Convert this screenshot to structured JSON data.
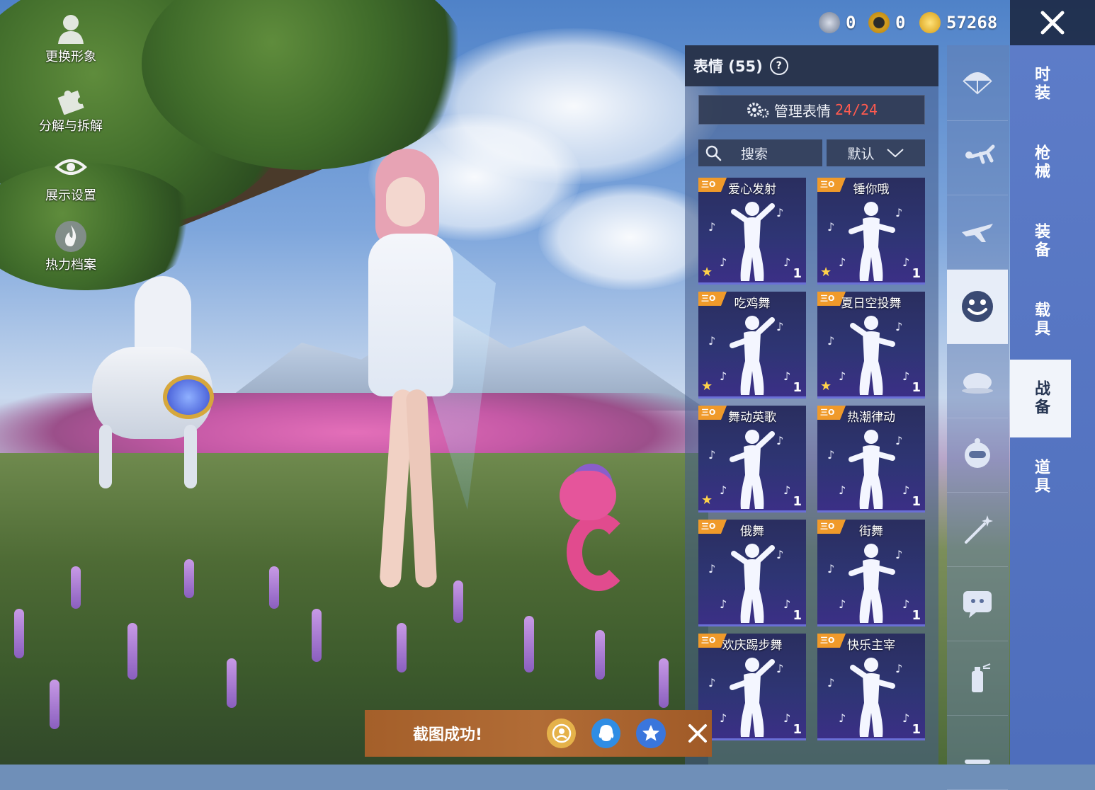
{
  "left_menu": [
    {
      "label": "更换形象",
      "icon": "person-icon"
    },
    {
      "label": "分解与拆解",
      "icon": "puzzle-icon"
    },
    {
      "label": "展示设置",
      "icon": "eye-icon"
    },
    {
      "label": "热力档案",
      "icon": "flame-icon"
    }
  ],
  "currency": [
    {
      "icon": "silver-coin-icon",
      "value": "0"
    },
    {
      "icon": "gold-token-icon",
      "value": "0"
    },
    {
      "icon": "lightning-coin-icon",
      "value": "57268"
    }
  ],
  "panel": {
    "title": "表情 (55)",
    "help": "?",
    "manage_label": "管理表情",
    "manage_count": "24/24",
    "search_placeholder": "搜索",
    "sort_label": "默认"
  },
  "emotes": [
    {
      "name": "爱心发射",
      "tag": "三O",
      "qty": "1",
      "starred": true
    },
    {
      "name": "锤你哦",
      "tag": "三O",
      "qty": "1",
      "starred": true
    },
    {
      "name": "吃鸡舞",
      "tag": "三O",
      "qty": "1",
      "starred": true
    },
    {
      "name": "夏日空投舞",
      "tag": "三O",
      "qty": "1",
      "starred": true
    },
    {
      "name": "舞动英歌",
      "tag": "三O",
      "qty": "1",
      "starred": true
    },
    {
      "name": "热潮律动",
      "tag": "三O",
      "qty": "1",
      "starred": false
    },
    {
      "name": "俄舞",
      "tag": "三O",
      "qty": "1",
      "starred": false
    },
    {
      "name": "街舞",
      "tag": "三O",
      "qty": "1",
      "starred": false
    },
    {
      "name": "欢庆踢步舞",
      "tag": "三O",
      "qty": "1",
      "starred": false
    },
    {
      "name": "快乐主宰",
      "tag": "三O",
      "qty": "1",
      "starred": false
    }
  ],
  "categories": [
    {
      "icon": "parachute-icon",
      "active": false
    },
    {
      "icon": "skydive-icon",
      "active": false
    },
    {
      "icon": "airplane-icon",
      "active": false
    },
    {
      "icon": "smiley-emote-icon",
      "active": true
    },
    {
      "icon": "roast-chicken-icon",
      "active": false
    },
    {
      "icon": "robot-pet-icon",
      "active": false
    },
    {
      "icon": "magic-wand-icon",
      "active": false
    },
    {
      "icon": "chat-bubble-icon",
      "active": false
    },
    {
      "icon": "spray-can-icon",
      "active": false
    },
    {
      "icon": "misc-icon",
      "active": false
    }
  ],
  "tabs": [
    {
      "label": "时装",
      "active": false
    },
    {
      "label": "枪械",
      "active": false
    },
    {
      "label": "装备",
      "active": false
    },
    {
      "label": "载具",
      "active": false
    },
    {
      "label": "战备",
      "active": true
    },
    {
      "label": "道具",
      "active": false
    }
  ],
  "toast": {
    "text": "截图成功!",
    "share_targets": [
      "app-share-icon",
      "qq-icon",
      "qzone-icon"
    ]
  },
  "colors": {
    "accent_red": "#ff5a4f",
    "tag_orange": "#f09a2a",
    "tab_blue": "#5d7cc8",
    "toast_brown": "#a45f2a"
  }
}
